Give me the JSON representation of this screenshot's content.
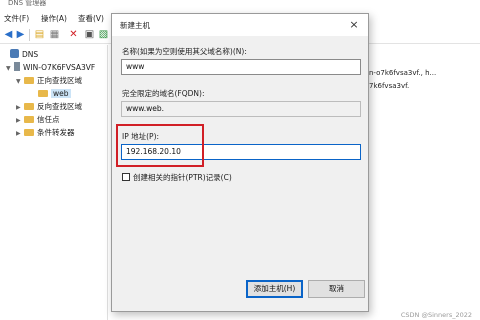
{
  "window": {
    "title": "DNS 管理器"
  },
  "menu": [
    "文件(F)",
    "操作(A)",
    "查看(V)"
  ],
  "toolbar": {
    "icons": [
      "back-arrow-icon",
      "forward-arrow-icon",
      "folder-icon",
      "properties-icon",
      "delete-icon",
      "refresh-icon",
      "export-icon"
    ]
  },
  "tree": {
    "root": "DNS",
    "server": "WIN-O7K6FVSA3VF",
    "forward_zones": "正向查找区域",
    "web_zone": "web",
    "reverse_zones": "反向查找区域",
    "trust_points": "信任点",
    "conditional_forwarders": "条件转发器"
  },
  "right_pane": {
    "row1": "n-o7k6fvsa3vf., h...",
    "row2": "7k6fvsa3vf."
  },
  "dialog": {
    "title": "新建主机",
    "close_label": "×",
    "name_label": "名称(如果为空则使用其父域名称)(N):",
    "name_value": "www",
    "fqdn_label": "完全限定的域名(FQDN):",
    "fqdn_value": "www.web.",
    "ip_label": "IP 地址(P):",
    "ip_value": "192.168.20.10",
    "ptr_label": "创建相关的指针(PTR)记录(C)",
    "add_button": "添加主机(H)",
    "cancel_button": "取消"
  },
  "watermark": "CSDN @Sinners_2022",
  "colors": {
    "highlight": "#d11f26",
    "focus": "#0a64c8"
  }
}
